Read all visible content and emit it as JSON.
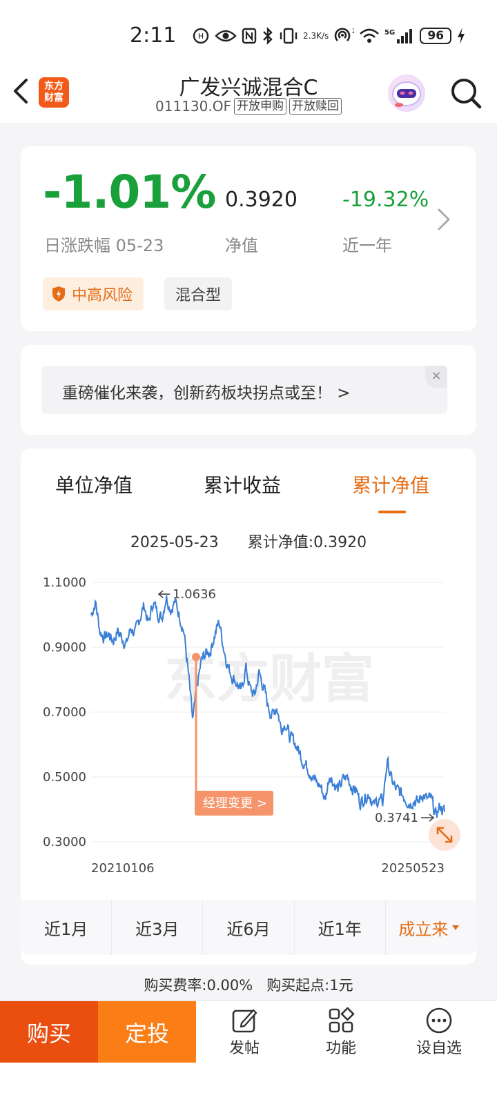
{
  "status_bar": {
    "time": "2:11",
    "speed_value": "2.3",
    "speed_unit": "K/s",
    "network": "5G",
    "battery": "96"
  },
  "header": {
    "app_logo_line1": "东方",
    "app_logo_line2": "财富",
    "title": "广发兴诚混合C",
    "code": "011130.OF",
    "tag_purchase": "开放申购",
    "tag_redeem": "开放赎回"
  },
  "summary": {
    "daily_change": "-1.01%",
    "daily_change_label": "日涨跌幅 05-23",
    "nav": "0.3920",
    "nav_label": "净值",
    "year_change": "-19.32%",
    "year_change_label": "近一年",
    "risk_tag": "中高风险",
    "type_tag": "混合型"
  },
  "banner": {
    "text": "重磅催化来袭，创新药板块拐点或至！ >",
    "close": "×"
  },
  "chart_tabs": [
    "单位净值",
    "累计收益",
    "累计净值"
  ],
  "chart_info": {
    "date": "2025-05-23",
    "label": "累计净值:0.3920"
  },
  "chart_data": {
    "type": "line",
    "x_start": "20210106",
    "x_end": "20250523",
    "y_ticks": [
      "1.1000",
      "0.9000",
      "0.7000",
      "0.5000",
      "0.3000"
    ],
    "ylim": [
      0.3,
      1.1
    ],
    "max_label": "1.0636",
    "min_label": "0.3741",
    "event_label": "经理变更 >",
    "watermark": "东方财富",
    "series": [
      {
        "values": [
          1.0,
          1.04,
          0.95,
          0.93,
          0.94,
          0.92,
          0.95,
          0.93,
          0.91,
          0.96,
          0.94,
          0.99,
          1.03,
          0.97,
          1.04,
          1.01,
          0.99,
          1.06,
          1.02,
          1.04,
          1.0,
          0.95,
          0.82,
          0.67,
          0.78,
          0.86,
          0.88,
          0.89,
          0.94,
          0.98,
          0.9,
          0.84,
          0.81,
          0.79,
          0.76,
          0.84,
          0.77,
          0.75,
          0.82,
          0.78,
          0.72,
          0.69,
          0.72,
          0.65,
          0.67,
          0.62,
          0.61,
          0.58,
          0.55,
          0.53,
          0.51,
          0.48,
          0.47,
          0.43,
          0.51,
          0.48,
          0.46,
          0.49,
          0.5,
          0.47,
          0.46,
          0.42,
          0.44,
          0.45,
          0.41,
          0.43,
          0.42,
          0.55,
          0.49,
          0.46,
          0.45,
          0.44,
          0.42,
          0.43,
          0.42,
          0.45,
          0.43,
          0.43,
          0.38,
          0.41,
          0.392
        ]
      }
    ]
  },
  "ranges": [
    "近1月",
    "近3月",
    "近6月",
    "近1年",
    "成立来"
  ],
  "fee": {
    "text": "购买费率:0.00%   购买起点:1元"
  },
  "bottom_bar": {
    "buy": "购买",
    "plan": "定投",
    "post": "发帖",
    "function": "功能",
    "watchlist": "设自选"
  },
  "colors": {
    "up_green": "#1aa03a",
    "accent_orange": "#e56d16",
    "line_blue": "#3a7fd5",
    "event_orange": "#f5946a"
  }
}
